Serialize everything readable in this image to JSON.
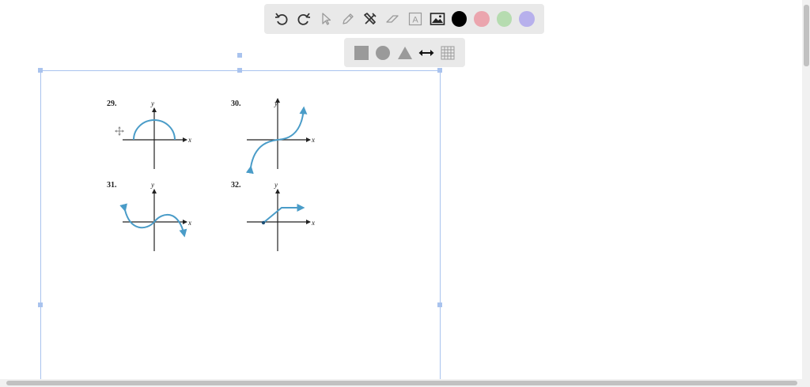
{
  "toolbar": {
    "tools": [
      {
        "name": "undo-icon"
      },
      {
        "name": "redo-icon"
      },
      {
        "name": "select-cursor-icon"
      },
      {
        "name": "pen-icon"
      },
      {
        "name": "tools-icon"
      },
      {
        "name": "eraser-icon"
      },
      {
        "name": "text-box-icon",
        "label": "A"
      },
      {
        "name": "image-icon"
      }
    ],
    "colors": [
      "#000000",
      "#eba5ae",
      "#b6dcb0",
      "#b7b0ec"
    ]
  },
  "shape_toolbar": {
    "tools": [
      "square-icon",
      "circle-icon",
      "triangle-icon",
      "double-arrow-icon",
      "grid-icon"
    ]
  },
  "graphs": [
    {
      "number": "29.",
      "y_label": "y",
      "x_label": "x"
    },
    {
      "number": "30.",
      "y_label": "y",
      "x_label": "x"
    },
    {
      "number": "31.",
      "y_label": "y",
      "x_label": "x"
    },
    {
      "number": "32.",
      "y_label": "y",
      "x_label": "x"
    }
  ],
  "colors": {
    "curve": "#4a9cc8",
    "selection": "#a9c3ee",
    "toolbar_bg": "#e9e9e9"
  }
}
